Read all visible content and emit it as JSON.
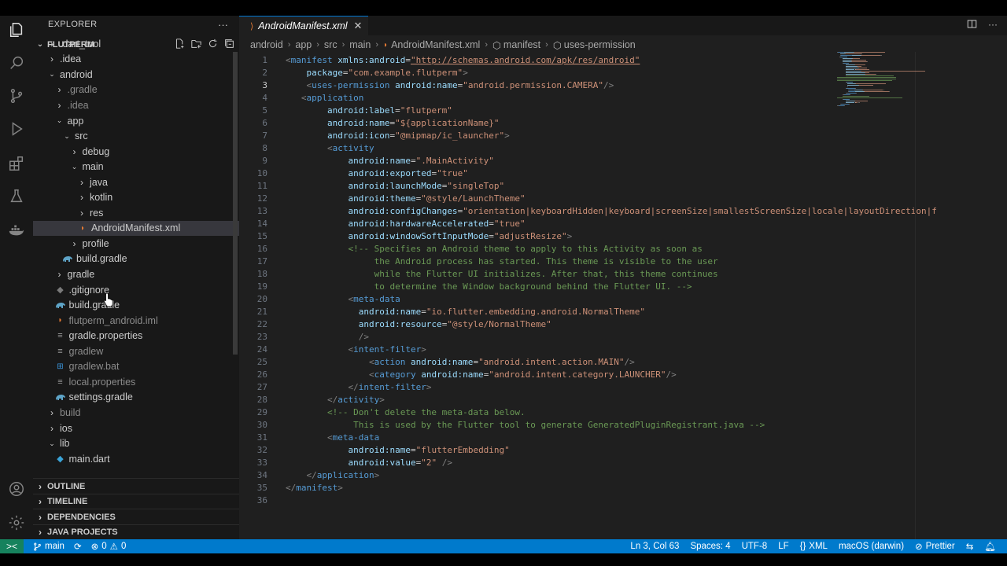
{
  "explorer": {
    "header": "EXPLORER",
    "more": "···",
    "root": "FLUTPERM",
    "items": [
      {
        "label": ".dart_tool",
        "kind": "folder",
        "open": false,
        "depth": 0
      },
      {
        "label": ".idea",
        "kind": "folder",
        "open": false,
        "depth": 0
      },
      {
        "label": "android",
        "kind": "folder",
        "open": true,
        "depth": 0
      },
      {
        "label": ".gradle",
        "kind": "folder",
        "open": false,
        "depth": 1,
        "dim": true
      },
      {
        "label": ".idea",
        "kind": "folder",
        "open": false,
        "depth": 1,
        "dim": true
      },
      {
        "label": "app",
        "kind": "folder",
        "open": true,
        "depth": 1
      },
      {
        "label": "src",
        "kind": "folder",
        "open": true,
        "depth": 2
      },
      {
        "label": "debug",
        "kind": "folder",
        "open": false,
        "depth": 3
      },
      {
        "label": "main",
        "kind": "folder",
        "open": true,
        "depth": 3
      },
      {
        "label": "java",
        "kind": "folder",
        "open": false,
        "depth": 4
      },
      {
        "label": "kotlin",
        "kind": "folder",
        "open": false,
        "depth": 4
      },
      {
        "label": "res",
        "kind": "folder",
        "open": false,
        "depth": 4
      },
      {
        "label": "AndroidManifest.xml",
        "kind": "xml",
        "depth": 4,
        "selected": true
      },
      {
        "label": "profile",
        "kind": "folder",
        "open": false,
        "depth": 3
      },
      {
        "label": "build.gradle",
        "kind": "gradle",
        "depth": 2
      },
      {
        "label": "gradle",
        "kind": "folder",
        "open": false,
        "depth": 1
      },
      {
        "label": ".gitignore",
        "kind": "git",
        "depth": 1
      },
      {
        "label": "build.gradle",
        "kind": "gradle",
        "depth": 1
      },
      {
        "label": "flutperm_android.iml",
        "kind": "xml",
        "depth": 1,
        "dim": true
      },
      {
        "label": "gradle.properties",
        "kind": "props",
        "depth": 1
      },
      {
        "label": "gradlew",
        "kind": "file",
        "depth": 1,
        "dim": true
      },
      {
        "label": "gradlew.bat",
        "kind": "bat",
        "depth": 1,
        "dim": true
      },
      {
        "label": "local.properties",
        "kind": "props",
        "depth": 1,
        "dim": true
      },
      {
        "label": "settings.gradle",
        "kind": "gradle",
        "depth": 1
      },
      {
        "label": "build",
        "kind": "folder",
        "open": false,
        "depth": 0,
        "dim": true
      },
      {
        "label": "ios",
        "kind": "folder",
        "open": false,
        "depth": 0
      },
      {
        "label": "lib",
        "kind": "folder",
        "open": true,
        "depth": 0
      },
      {
        "label": "main.dart",
        "kind": "dart",
        "depth": 1
      }
    ],
    "sections": [
      "OUTLINE",
      "TIMELINE",
      "DEPENDENCIES",
      "JAVA PROJECTS"
    ]
  },
  "editor": {
    "tab_label": "AndroidManifest.xml",
    "breadcrumb": [
      "android",
      "app",
      "src",
      "main",
      "AndroidManifest.xml",
      "manifest",
      "uses-permission"
    ],
    "current_line": 3,
    "lines": [
      [
        [
          "t-pun",
          "<"
        ],
        [
          "t-tag",
          "manifest "
        ],
        [
          "t-attr",
          "xmlns:android"
        ],
        [
          "t-def",
          "="
        ],
        [
          "t-link",
          "\"http://schemas.android.com/apk/res/android\""
        ]
      ],
      [
        [
          "t-def",
          "    "
        ],
        [
          "t-attr",
          "package"
        ],
        [
          "t-def",
          "="
        ],
        [
          "t-str",
          "\"com.example.flutperm\""
        ],
        [
          "t-pun",
          ">"
        ]
      ],
      [
        [
          "t-def",
          "    "
        ],
        [
          "t-pun",
          "<"
        ],
        [
          "t-tag",
          "uses-permission "
        ],
        [
          "t-attr",
          "android:name"
        ],
        [
          "t-def",
          "="
        ],
        [
          "t-str",
          "\"android.permission.CAMERA\""
        ],
        [
          "t-pun",
          "/>"
        ]
      ],
      [
        [
          "t-def",
          "   "
        ],
        [
          "t-pun",
          "<"
        ],
        [
          "t-tag",
          "application"
        ]
      ],
      [
        [
          "t-def",
          "        "
        ],
        [
          "t-attr",
          "android:label"
        ],
        [
          "t-def",
          "="
        ],
        [
          "t-str",
          "\"flutperm\""
        ]
      ],
      [
        [
          "t-def",
          "        "
        ],
        [
          "t-attr",
          "android:name"
        ],
        [
          "t-def",
          "="
        ],
        [
          "t-str",
          "\"${applicationName}\""
        ]
      ],
      [
        [
          "t-def",
          "        "
        ],
        [
          "t-attr",
          "android:icon"
        ],
        [
          "t-def",
          "="
        ],
        [
          "t-str",
          "\"@mipmap/ic_launcher\""
        ],
        [
          "t-pun",
          ">"
        ]
      ],
      [
        [
          "t-def",
          "        "
        ],
        [
          "t-pun",
          "<"
        ],
        [
          "t-tag",
          "activity"
        ]
      ],
      [
        [
          "t-def",
          "            "
        ],
        [
          "t-attr",
          "android:name"
        ],
        [
          "t-def",
          "="
        ],
        [
          "t-str",
          "\".MainActivity\""
        ]
      ],
      [
        [
          "t-def",
          "            "
        ],
        [
          "t-attr",
          "android:exported"
        ],
        [
          "t-def",
          "="
        ],
        [
          "t-str",
          "\"true\""
        ]
      ],
      [
        [
          "t-def",
          "            "
        ],
        [
          "t-attr",
          "android:launchMode"
        ],
        [
          "t-def",
          "="
        ],
        [
          "t-str",
          "\"singleTop\""
        ]
      ],
      [
        [
          "t-def",
          "            "
        ],
        [
          "t-attr",
          "android:theme"
        ],
        [
          "t-def",
          "="
        ],
        [
          "t-str",
          "\"@style/LaunchTheme\""
        ]
      ],
      [
        [
          "t-def",
          "            "
        ],
        [
          "t-attr",
          "android:configChanges"
        ],
        [
          "t-def",
          "="
        ],
        [
          "t-str",
          "\"orientation|keyboardHidden|keyboard|screenSize|smallestScreenSize|locale|layoutDirection|f"
        ]
      ],
      [
        [
          "t-def",
          "            "
        ],
        [
          "t-attr",
          "android:hardwareAccelerated"
        ],
        [
          "t-def",
          "="
        ],
        [
          "t-str",
          "\"true\""
        ]
      ],
      [
        [
          "t-def",
          "            "
        ],
        [
          "t-attr",
          "android:windowSoftInputMode"
        ],
        [
          "t-def",
          "="
        ],
        [
          "t-str",
          "\"adjustResize\""
        ],
        [
          "t-pun",
          ">"
        ]
      ],
      [
        [
          "t-def",
          "            "
        ],
        [
          "t-cmt",
          "<!-- Specifies an Android theme to apply to this Activity as soon as"
        ]
      ],
      [
        [
          "t-cmt",
          "                 the Android process has started. This theme is visible to the user"
        ]
      ],
      [
        [
          "t-cmt",
          "                 while the Flutter UI initializes. After that, this theme continues"
        ]
      ],
      [
        [
          "t-cmt",
          "                 to determine the Window background behind the Flutter UI. -->"
        ]
      ],
      [
        [
          "t-def",
          "            "
        ],
        [
          "t-pun",
          "<"
        ],
        [
          "t-tag",
          "meta-data"
        ]
      ],
      [
        [
          "t-def",
          "              "
        ],
        [
          "t-attr",
          "android:name"
        ],
        [
          "t-def",
          "="
        ],
        [
          "t-str",
          "\"io.flutter.embedding.android.NormalTheme\""
        ]
      ],
      [
        [
          "t-def",
          "              "
        ],
        [
          "t-attr",
          "android:resource"
        ],
        [
          "t-def",
          "="
        ],
        [
          "t-str",
          "\"@style/NormalTheme\""
        ]
      ],
      [
        [
          "t-def",
          "              "
        ],
        [
          "t-pun",
          "/>"
        ]
      ],
      [
        [
          "t-def",
          "            "
        ],
        [
          "t-pun",
          "<"
        ],
        [
          "t-tag",
          "intent-filter"
        ],
        [
          "t-pun",
          ">"
        ]
      ],
      [
        [
          "t-def",
          "                "
        ],
        [
          "t-pun",
          "<"
        ],
        [
          "t-tag",
          "action "
        ],
        [
          "t-attr",
          "android:name"
        ],
        [
          "t-def",
          "="
        ],
        [
          "t-str",
          "\"android.intent.action.MAIN\""
        ],
        [
          "t-pun",
          "/>"
        ]
      ],
      [
        [
          "t-def",
          "                "
        ],
        [
          "t-pun",
          "<"
        ],
        [
          "t-tag",
          "category "
        ],
        [
          "t-attr",
          "android:name"
        ],
        [
          "t-def",
          "="
        ],
        [
          "t-str",
          "\"android.intent.category.LAUNCHER\""
        ],
        [
          "t-pun",
          "/>"
        ]
      ],
      [
        [
          "t-def",
          "            "
        ],
        [
          "t-pun",
          "</"
        ],
        [
          "t-tag",
          "intent-filter"
        ],
        [
          "t-pun",
          ">"
        ]
      ],
      [
        [
          "t-def",
          "        "
        ],
        [
          "t-pun",
          "</"
        ],
        [
          "t-tag",
          "activity"
        ],
        [
          "t-pun",
          ">"
        ]
      ],
      [
        [
          "t-def",
          "        "
        ],
        [
          "t-cmt",
          "<!-- Don't delete the meta-data below."
        ]
      ],
      [
        [
          "t-cmt",
          "             This is used by the Flutter tool to generate GeneratedPluginRegistrant.java -->"
        ]
      ],
      [
        [
          "t-def",
          "        "
        ],
        [
          "t-pun",
          "<"
        ],
        [
          "t-tag",
          "meta-data"
        ]
      ],
      [
        [
          "t-def",
          "            "
        ],
        [
          "t-attr",
          "android:name"
        ],
        [
          "t-def",
          "="
        ],
        [
          "t-str",
          "\"flutterEmbedding\""
        ]
      ],
      [
        [
          "t-def",
          "            "
        ],
        [
          "t-attr",
          "android:value"
        ],
        [
          "t-def",
          "="
        ],
        [
          "t-str",
          "\"2\""
        ],
        [
          "t-def",
          " "
        ],
        [
          "t-pun",
          "/>"
        ]
      ],
      [
        [
          "t-def",
          "    "
        ],
        [
          "t-pun",
          "</"
        ],
        [
          "t-tag",
          "application"
        ],
        [
          "t-pun",
          ">"
        ]
      ],
      [
        [
          "t-pun",
          "</"
        ],
        [
          "t-tag",
          "manifest"
        ],
        [
          "t-pun",
          ">"
        ]
      ],
      [
        [
          "t-def",
          ""
        ]
      ]
    ]
  },
  "statusbar": {
    "remote": "><",
    "branch": "main",
    "sync": "⟳",
    "errors": "0",
    "warnings": "0",
    "position": "Ln 3, Col 63",
    "spaces": "Spaces: 4",
    "encoding": "UTF-8",
    "eol": "LF",
    "language": "XML",
    "platform": "macOS (darwin)",
    "formatter": "Prettier"
  }
}
